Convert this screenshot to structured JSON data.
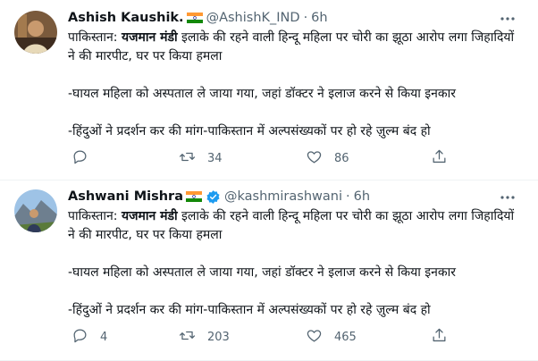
{
  "tweets": [
    {
      "name": "Ashish Kaushik.",
      "handle": "@AshishK_IND",
      "time": "6h",
      "line1_prefix": "पाकिस्तान: ",
      "line1_bold": "यजमान मंडी",
      "line1_rest": " इलाके की रहने वाली हिन्दू महिला पर चोरी का झूठा आरोप लगा जिहादियों ने की मारपीट, घर पर किया हमला",
      "line2": "-घायल महिला को अस्पताल ले जाया गया, जहां डॉक्टर ने इलाज करने से किया इनकार",
      "line3": "-हिंदुओं ने प्रदर्शन कर की मांग-पाकिस्तान में अल्पसंख्यकों पर हो रहे ज़ुल्म बंद हो",
      "replies": "",
      "retweets": "34",
      "likes": "86"
    },
    {
      "name": "Ashwani Mishra",
      "handle": "@kashmirashwani",
      "time": "6h",
      "line1_prefix": "पाकिस्तान: ",
      "line1_bold": "यजमान मंडी",
      "line1_rest": " इलाके की रहने वाली हिन्दू महिला पर चोरी का झूठा आरोप लगा जिहादियों ने की मारपीट, घर पर किया हमला",
      "line2": "-घायल महिला को अस्पताल ले जाया गया, जहां डॉक्टर ने इलाज करने से किया इनकार",
      "line3": "-हिंदुओं ने प्रदर्शन कर की मांग-पाकिस्तान में अल्पसंख्यकों पर हो रहे ज़ुल्म बंद हो",
      "replies": "4",
      "retweets": "203",
      "likes": "465"
    }
  ],
  "separator": "·",
  "colors": {
    "muted": "#536471",
    "verified": "#1d9bf0",
    "text": "#0f1419"
  },
  "icons": [
    "flag-india-icon",
    "verified-badge-icon",
    "more-icon",
    "reply-icon",
    "retweet-icon",
    "like-icon",
    "share-icon"
  ]
}
